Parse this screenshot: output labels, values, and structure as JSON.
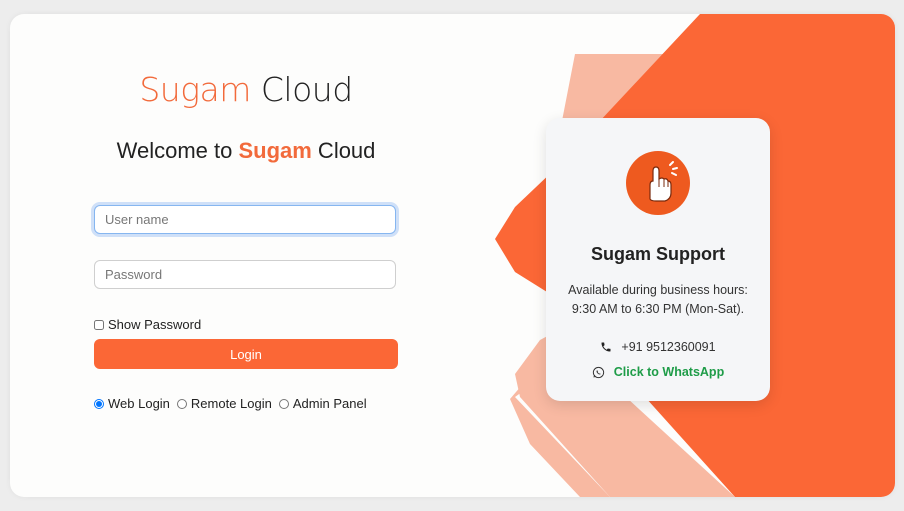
{
  "logo": {
    "part1": "Sugam",
    "part2": " Cloud"
  },
  "welcome": {
    "prefix": "Welcome to ",
    "brand": "Sugam",
    "suffix": " Cloud"
  },
  "form": {
    "username_placeholder": "User name",
    "password_placeholder": "Password",
    "show_password_label": "Show Password",
    "login_label": "Login"
  },
  "login_modes": [
    {
      "label": "Web Login",
      "selected": true
    },
    {
      "label": "Remote Login",
      "selected": false
    },
    {
      "label": "Admin Panel",
      "selected": false
    }
  ],
  "support": {
    "title": "Sugam Support",
    "hours_line1": "Available during business hours:",
    "hours_line2": "9:30 AM to 6:30 PM (Mon-Sat).",
    "phone": "+91 9512360091",
    "whatsapp": "Click to WhatsApp"
  },
  "colors": {
    "brand_orange": "#fb6736",
    "light_orange": "#f8b9a2",
    "whatsapp_green": "#1e9c48"
  },
  "icons": [
    "support-hand-icon",
    "phone-icon",
    "whatsapp-icon"
  ]
}
